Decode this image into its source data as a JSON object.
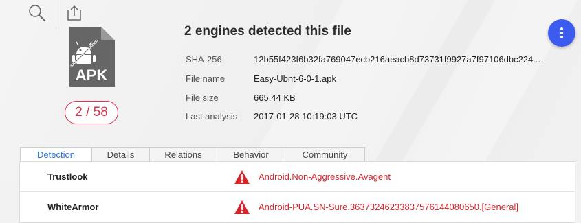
{
  "toolbar": {
    "search_icon": "search-icon",
    "upload_icon": "upload-icon"
  },
  "file": {
    "type_label": "APK",
    "score": "2 / 58",
    "title": "2 engines detected this file",
    "details": [
      {
        "key": "SHA-256",
        "value": "12b55f423f6b32fa769047ecb216aeacb8d73731f9927a7f97106dbc224..."
      },
      {
        "key": "File name",
        "value": "Easy-Ubnt-6-0-1.apk"
      },
      {
        "key": "File size",
        "value": "665.44 KB"
      },
      {
        "key": "Last analysis",
        "value": "2017-01-28 10:19:03 UTC"
      }
    ]
  },
  "tabs": [
    "Detection",
    "Details",
    "Relations",
    "Behavior",
    "Community"
  ],
  "detections": [
    {
      "engine": "Trustlook",
      "verdict": "Android.Non-Aggressive.Avagent"
    },
    {
      "engine": "WhiteArmor",
      "verdict": "Android-PUA.SN-Sure.3637324623383757614408065​0.[General]"
    }
  ],
  "colors": {
    "accent_blue": "#3c5cf0",
    "malicious_red": "#d6262c",
    "score_red": "#e0304d",
    "active_tab": "#2a72d6"
  }
}
